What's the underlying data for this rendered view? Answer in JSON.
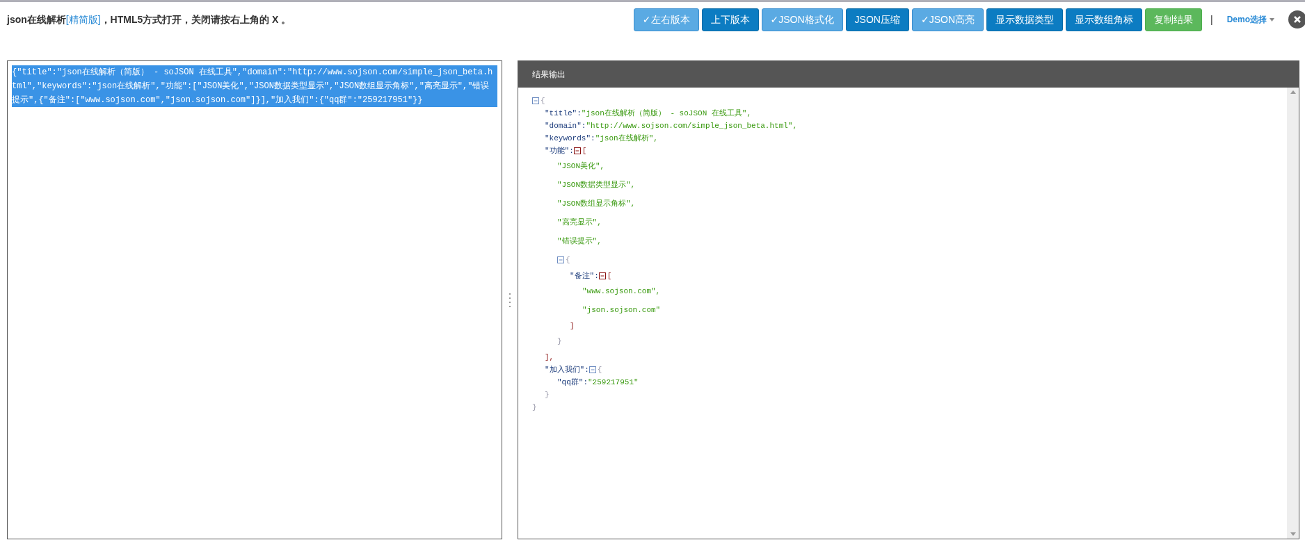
{
  "header": {
    "title_before": "json在线解析",
    "title_link": "[精简版]",
    "title_after": "，HTML5方式打开，关闭请按右上角的 X 。"
  },
  "toolbar": {
    "buttons": [
      {
        "label": "✓左右版本",
        "kind": "primary",
        "checked": true
      },
      {
        "label": "上下版本",
        "kind": "primary",
        "checked": false
      },
      {
        "label": "✓JSON格式化",
        "kind": "primary",
        "checked": true
      },
      {
        "label": "JSON压缩",
        "kind": "primary",
        "checked": false
      },
      {
        "label": "✓JSON高亮",
        "kind": "primary",
        "checked": true
      },
      {
        "label": "显示数据类型",
        "kind": "primary",
        "checked": false
      },
      {
        "label": "显示数组角标",
        "kind": "primary",
        "checked": false
      },
      {
        "label": "复制结果",
        "kind": "success"
      }
    ],
    "separator": "|",
    "demo_menu": "Demo选择"
  },
  "input": {
    "text": "{\"title\":\"json在线解析（简版） - soJSON 在线工具\",\"domain\":\"http://www.sojson.com/simple_json_beta.html\",\"keywords\":\"json在线解析\",\"功能\":[\"JSON美化\",\"JSON数据类型显示\",\"JSON数组显示角标\",\"高亮显示\",\"错误提示\",{\"备注\":[\"www.sojson.com\",\"json.sojson.com\"]}],\"加入我们\":{\"qq群\":\"259217951\"}}",
    "selected": true
  },
  "output": {
    "title": "结果输出",
    "tree": [
      {
        "kind": "object",
        "open": "{",
        "close": "}",
        "expanded": true,
        "children": [
          {
            "kind": "string",
            "key": "\"title\":",
            "value": "\"json在线解析（简版） - soJSON 在线工具\","
          },
          {
            "kind": "string",
            "key": "\"domain\":",
            "value": "\"http://www.sojson.com/simple_json_beta.html\","
          },
          {
            "kind": "string",
            "key": "\"keywords\":",
            "value": "\"json在线解析\","
          },
          {
            "kind": "array",
            "key": "\"功能\":",
            "open": "[",
            "close": "],",
            "expanded": true,
            "children": [
              {
                "kind": "string",
                "value": "\"JSON美化\","
              },
              {
                "kind": "string",
                "value": "\"JSON数据类型显示\","
              },
              {
                "kind": "string",
                "value": "\"JSON数组显示角标\","
              },
              {
                "kind": "string",
                "value": "\"高亮显示\","
              },
              {
                "kind": "string",
                "value": "\"错误提示\","
              },
              {
                "kind": "object",
                "open": "{",
                "close": "}",
                "expanded": true,
                "children": [
                  {
                    "kind": "array",
                    "key": "\"备注\":",
                    "open": "[",
                    "close": "]",
                    "expanded": true,
                    "children": [
                      {
                        "kind": "string",
                        "value": "\"www.sojson.com\","
                      },
                      {
                        "kind": "string",
                        "value": "\"json.sojson.com\""
                      }
                    ]
                  }
                ]
              }
            ]
          },
          {
            "kind": "object",
            "key": "\"加入我们\":",
            "open": "{",
            "close": "}",
            "expanded": true,
            "children": [
              {
                "kind": "string",
                "key": "\"qq群\":",
                "value": "\"259217951\""
              }
            ]
          }
        ]
      }
    ]
  }
}
